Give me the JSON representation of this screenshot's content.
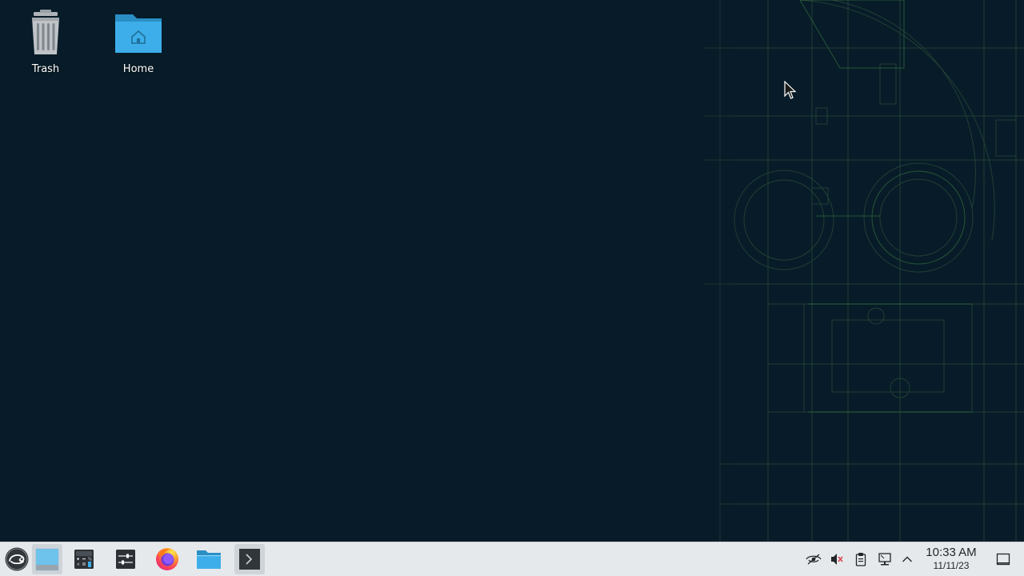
{
  "desktop": {
    "icons": [
      {
        "id": "trash",
        "label": "Trash",
        "icon": "trash-icon"
      },
      {
        "id": "home",
        "label": "Home",
        "icon": "home-folder-icon"
      }
    ]
  },
  "taskbar": {
    "launchers": [
      {
        "id": "app-launcher",
        "icon": "opensuse-gecko-icon"
      },
      {
        "id": "show-desktop",
        "icon": "desktop-window-icon"
      },
      {
        "id": "calculator",
        "icon": "calculator-icon"
      },
      {
        "id": "system-settings",
        "icon": "settings-sliders-icon"
      },
      {
        "id": "firefox",
        "icon": "firefox-icon"
      },
      {
        "id": "file-manager",
        "icon": "folder-icon"
      },
      {
        "id": "terminal",
        "icon": "terminal-icon"
      }
    ],
    "tray": [
      {
        "id": "privacy",
        "icon": "eye-slash-icon"
      },
      {
        "id": "volume",
        "icon": "speaker-muted-icon"
      },
      {
        "id": "clipboard",
        "icon": "clipboard-icon"
      },
      {
        "id": "network",
        "icon": "wired-network-icon"
      },
      {
        "id": "expand",
        "icon": "chevron-up-icon"
      },
      {
        "id": "notifications",
        "icon": "notification-square-icon"
      }
    ],
    "clock": {
      "time": "10:33 AM",
      "date": "11/11/23"
    }
  },
  "colors": {
    "wallpaper": "#071c28",
    "wallpaper_lines": "#2f5a3a",
    "taskbar": "#e6e9ec",
    "folder_blue": "#3daee9"
  }
}
